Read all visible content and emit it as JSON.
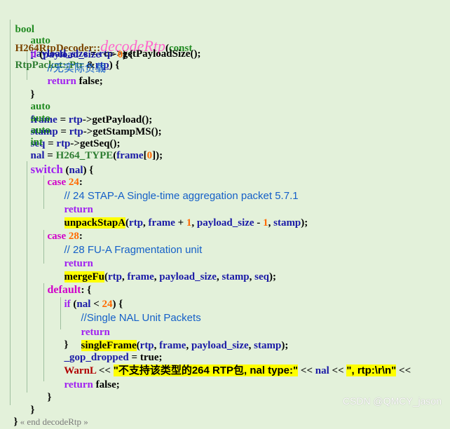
{
  "code": {
    "signature": {
      "ret": "bool",
      "cls": "H264RtpDecoder::",
      "fn": "decodeRtp",
      "open": "(",
      "constkw": "const",
      "ptype": "RtpPacket::Ptr",
      "amp": " &",
      "param": "rtp",
      "close": ") {"
    },
    "l2": {
      "auto": "auto",
      "v": "payload_size",
      "eq": " = ",
      "r": "rtp",
      "arrow": "->",
      "call": "getPayloadSize",
      "end": "();"
    },
    "l3": {
      "kw": "if",
      "open": " (",
      "v": "payload_size",
      "op": " <= ",
      "n": "0",
      "end": ") {"
    },
    "l4": {
      "cm": "//无实际负载"
    },
    "l5": {
      "kw": "return",
      "v": " false;"
    },
    "l6": {
      "t": "}"
    },
    "l7": {
      "auto": "auto",
      "v": "frame",
      "eq": " = ",
      "r": "rtp",
      "arrow": "->",
      "call": "getPayload",
      "end": "();"
    },
    "l8": {
      "auto": "auto",
      "v": "stamp",
      "eq": " = ",
      "r": "rtp",
      "arrow": "->",
      "call": "getStampMS",
      "end": "();"
    },
    "l9": {
      "auto": "auto",
      "v": "seq",
      "eq": " = ",
      "r": "rtp",
      "arrow": "->",
      "call": "getSeq",
      "end": "();"
    },
    "l10": {
      "int": "int",
      "v": "nal",
      "eq": " = ",
      "m": "H264_TYPE",
      "open": "(",
      "a": "frame",
      "b1": "[",
      "n": "0",
      "b2": "]",
      "end": ");"
    },
    "l11": {
      "kw": "switch",
      "open": " (",
      "v": "nal",
      "end": ") {"
    },
    "l12": {
      "kw": "case",
      "n": " 24",
      "c": ":"
    },
    "l13": {
      "cm": "// 24 STAP-A Single-time aggregation packet 5.7.1"
    },
    "l14": {
      "kw": "return",
      "call": "unpackStapA",
      "o": "(",
      "a": "rtp",
      "c1": ", ",
      "b": "frame",
      "p": " + ",
      "n": "1",
      "c2": ", ",
      "d": "payload_size",
      "m": " - ",
      "n2": "1",
      "c3": ", ",
      "e": "stamp",
      "end": ");"
    },
    "l15": {
      "kw": "case",
      "n": " 28",
      "c": ":"
    },
    "l16": {
      "cm": "// 28 FU-A Fragmentation unit"
    },
    "l17": {
      "kw": "return",
      "call": "mergeFu",
      "o": "(",
      "a": "rtp",
      "c1": ", ",
      "b": "frame",
      "c2": ", ",
      "d": "payload_size",
      "c3": ", ",
      "e": "stamp",
      "c4": ", ",
      "f": "seq",
      "end": ");"
    },
    "l18": {
      "kw": "default",
      "end": ": {"
    },
    "l19": {
      "kw": "if",
      "open": " (",
      "v": "nal",
      "op": " < ",
      "n": "24",
      "end": ") {"
    },
    "l20": {
      "cm": "//Single NAL Unit Packets"
    },
    "l21": {
      "kw": "return",
      "call": "singleFrame",
      "o": "(",
      "a": "rtp",
      "c1": ", ",
      "b": "frame",
      "c2": ", ",
      "d": "payload_size",
      "c3": ", ",
      "e": "stamp",
      "end": ");"
    },
    "l22": {
      "t": "}"
    },
    "l23": {
      "v": "_gop_dropped",
      "eq": " = ",
      "val": "true;"
    },
    "l24": {
      "w": "WarnL",
      "s1": " << ",
      "str": "\"不支持该类型的264 RTP包, nal type:\"",
      "s2": " << ",
      "v": "nal",
      "s3": " << ",
      "str2": "\", rtp:\\r\\n\"",
      "s4": " <<"
    },
    "l25": {
      "kw": "return",
      "v": " false;"
    },
    "l26": {
      "t": "}"
    },
    "l27": {
      "t": "}"
    },
    "l28": {
      "t": "}",
      "tag": " « end decodeRtp »"
    }
  },
  "watermark": "CSDN @QMCY_jason"
}
